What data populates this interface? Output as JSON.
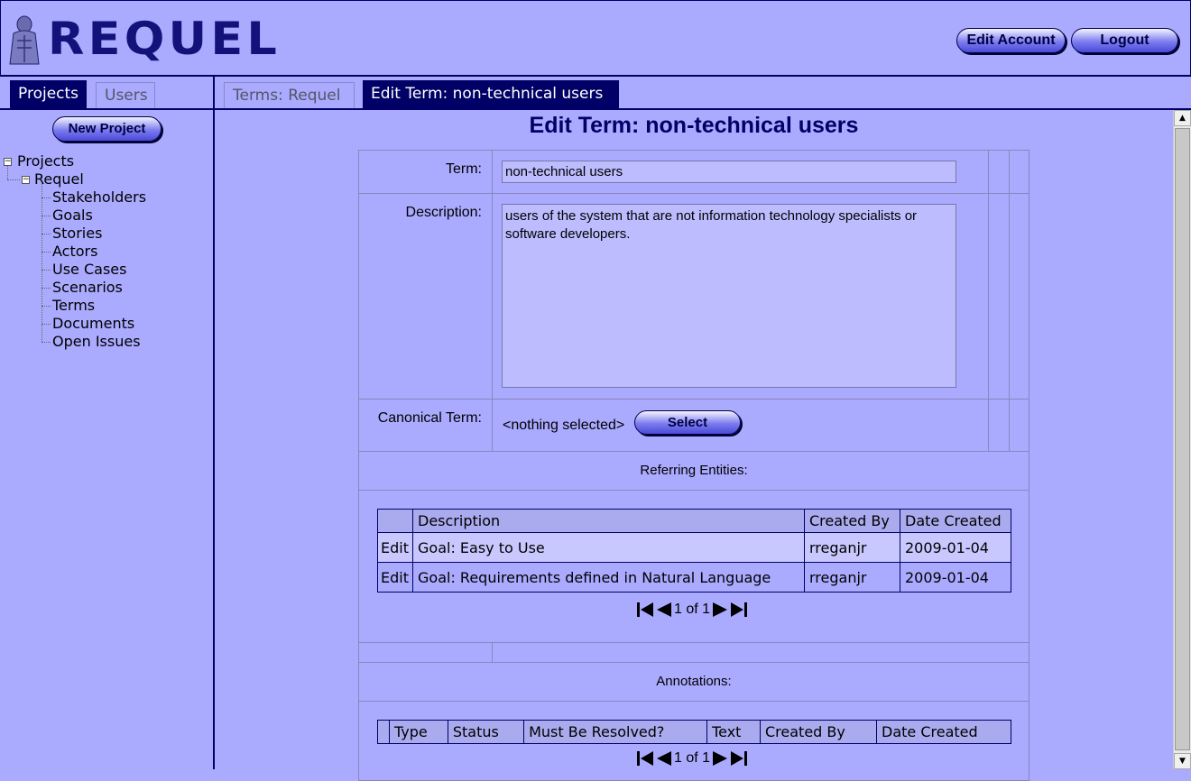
{
  "header": {
    "logo_text": "REQUEL",
    "edit_account_label": "Edit Account",
    "logout_label": "Logout"
  },
  "sidebar": {
    "tabs": [
      {
        "label": "Projects",
        "active": true
      },
      {
        "label": "Users",
        "active": false
      }
    ],
    "new_project_label": "New Project",
    "tree": {
      "root": "Projects",
      "project": "Requel",
      "items": [
        "Stakeholders",
        "Goals",
        "Stories",
        "Actors",
        "Use Cases",
        "Scenarios",
        "Terms",
        "Documents",
        "Open Issues"
      ]
    }
  },
  "main": {
    "tabs": [
      {
        "label": "Terms: Requel",
        "active": false
      },
      {
        "label": "Edit Term: non-technical users",
        "active": true
      }
    ],
    "title": "Edit Term: non-technical users",
    "form": {
      "term_label": "Term:",
      "term_value": "non-technical users",
      "description_label": "Description:",
      "description_value": "users of the system that are not information technology specialists or software developers.",
      "canonical_label": "Canonical Term:",
      "canonical_value": "<nothing selected>",
      "select_label": "Select",
      "referring_label": "Referring Entities:",
      "annotations_label": "Annotations:"
    },
    "referring_table": {
      "headers": [
        "",
        "Description",
        "Created By",
        "Date Created"
      ],
      "rows": [
        {
          "action": "Edit",
          "description": "Goal: Easy to Use",
          "created_by": "rreganjr",
          "date_created": "2009-01-04"
        },
        {
          "action": "Edit",
          "description": "Goal: Requirements defined in Natural Language",
          "created_by": "rreganjr",
          "date_created": "2009-01-04"
        }
      ],
      "pager": "1 of 1"
    },
    "annotations_table": {
      "headers": [
        "",
        "Type",
        "Status",
        "Must Be Resolved?",
        "Text",
        "Created By",
        "Date Created"
      ],
      "pager": "1 of 1"
    }
  },
  "colors": {
    "background": "#aaaaff",
    "accent": "#000066",
    "field": "#bcbcff"
  }
}
